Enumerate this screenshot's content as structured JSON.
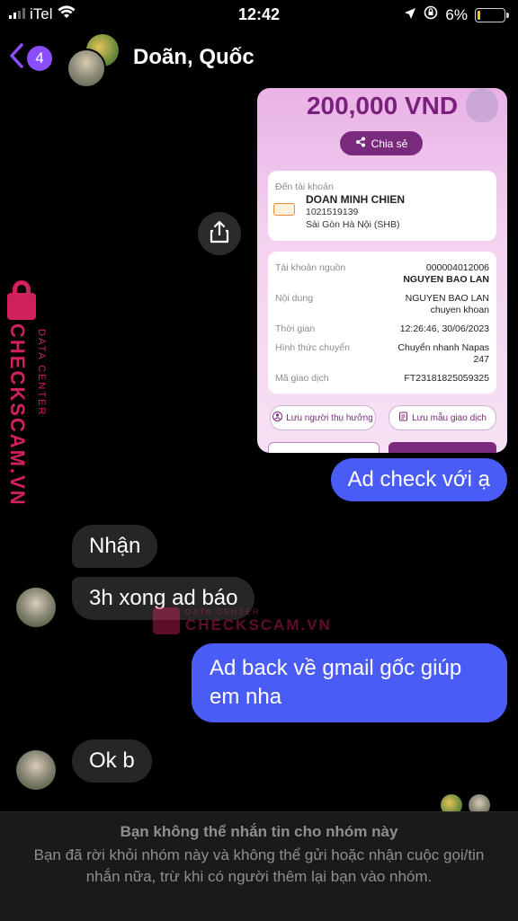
{
  "status_bar": {
    "carrier": "iTel",
    "time": "12:42",
    "battery": "6%"
  },
  "header": {
    "unread_count": "4",
    "title": "Doãn, Quốc"
  },
  "transfer_card": {
    "amount": "200,000 VND",
    "share_label": "Chia sẻ",
    "to_account_label": "Đến tài khoản",
    "recipient_name": "DOAN MINH CHIEN",
    "recipient_account": "1021519139",
    "recipient_bank": "Sài Gòn Hà Nội (SHB)",
    "source_account_label": "Tài khoản nguồn",
    "source_account_number": "000004012006",
    "source_account_name": "NGUYEN BAO LAN",
    "content_label": "Nội dung",
    "content_value_1": "NGUYEN BAO LAN",
    "content_value_2": "chuyen khoan",
    "time_label": "Thời gian",
    "time_value": "12:26:46, 30/06/2023",
    "method_label": "Hình thức chuyển",
    "method_value_1": "Chuyển nhanh Napas",
    "method_value_2": "247",
    "txid_label": "Mã giao dịch",
    "txid_value": "FT23181825059325",
    "save_recipient_label": "Lưu người thụ hưởng",
    "save_template_label": "Lưu mẫu giao dịch"
  },
  "messages": [
    {
      "direction": "out",
      "text": "Ad check với ạ"
    },
    {
      "direction": "in",
      "text": "Nhận"
    },
    {
      "direction": "in",
      "text": "3h xong ad báo"
    },
    {
      "direction": "out_line1",
      "text": "Ad back về gmail gốc giúp"
    },
    {
      "direction": "out_line2",
      "text": "em nha"
    },
    {
      "direction": "in",
      "text": "Ok b"
    }
  ],
  "watermark": {
    "brand": "CHECKSCAM.VN",
    "sub": "DATA CENTER"
  },
  "footer": {
    "title": "Bạn không thể nhắn tin cho nhóm này",
    "desc": "Bạn đã rời khỏi nhóm này và không thể gửi hoặc nhận cuộc gọi/tin nhắn nữa, trừ khi có người thêm lại bạn vào nhóm."
  },
  "colors": {
    "outgoing_bubble": "#4a5cf6",
    "incoming_bubble": "#262628",
    "accent": "#8a4dff",
    "watermark": "#d0215a"
  }
}
